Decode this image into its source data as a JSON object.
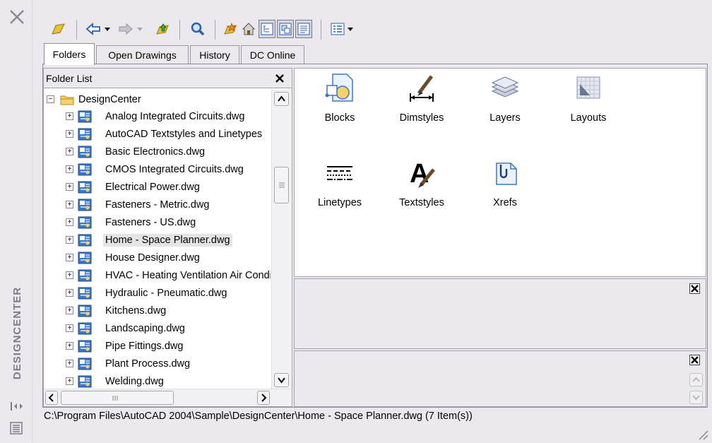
{
  "panel": {
    "vertical_title": "DESIGNCENTER"
  },
  "toolbar": {
    "buttons": [
      "load-icon",
      "back-icon",
      "back-dropdown-icon",
      "forward-icon",
      "forward-dropdown-icon",
      "up-icon",
      "search-icon",
      "favorites-icon",
      "home-icon",
      "tree-view-toggle-icon",
      "preview-toggle-icon",
      "description-toggle-icon",
      "views-icon",
      "views-dropdown-icon"
    ]
  },
  "tabs": [
    "Folders",
    "Open Drawings",
    "History",
    "DC Online"
  ],
  "tree": {
    "header": "Folder List",
    "root": "DesignCenter",
    "items": [
      "Analog Integrated Circuits.dwg",
      "AutoCAD Textstyles and Linetypes",
      "Basic Electronics.dwg",
      "CMOS Integrated Circuits.dwg",
      "Electrical Power.dwg",
      "Fasteners - Metric.dwg",
      "Fasteners - US.dwg",
      "Home - Space Planner.dwg",
      "House Designer.dwg",
      "HVAC - Heating Ventilation Air Conditioning.dwg",
      "Hydraulic - Pneumatic.dwg",
      "Kitchens.dwg",
      "Landscaping.dwg",
      "Pipe Fittings.dwg",
      "Plant Process.dwg",
      "Welding.dwg"
    ],
    "selected": "Home - Space Planner.dwg"
  },
  "content": {
    "items": [
      "Blocks",
      "Dimstyles",
      "Layers",
      "Layouts",
      "Linetypes",
      "Textstyles",
      "Xrefs"
    ]
  },
  "status": "C:\\Program Files\\AutoCAD 2004\\Sample\\DesignCenter\\Home - Space Planner.dwg (7 Item(s))",
  "colors": {
    "accent": "#3b77c9",
    "selection": "#e4e4e6",
    "chrome": "#ebe9ed"
  }
}
